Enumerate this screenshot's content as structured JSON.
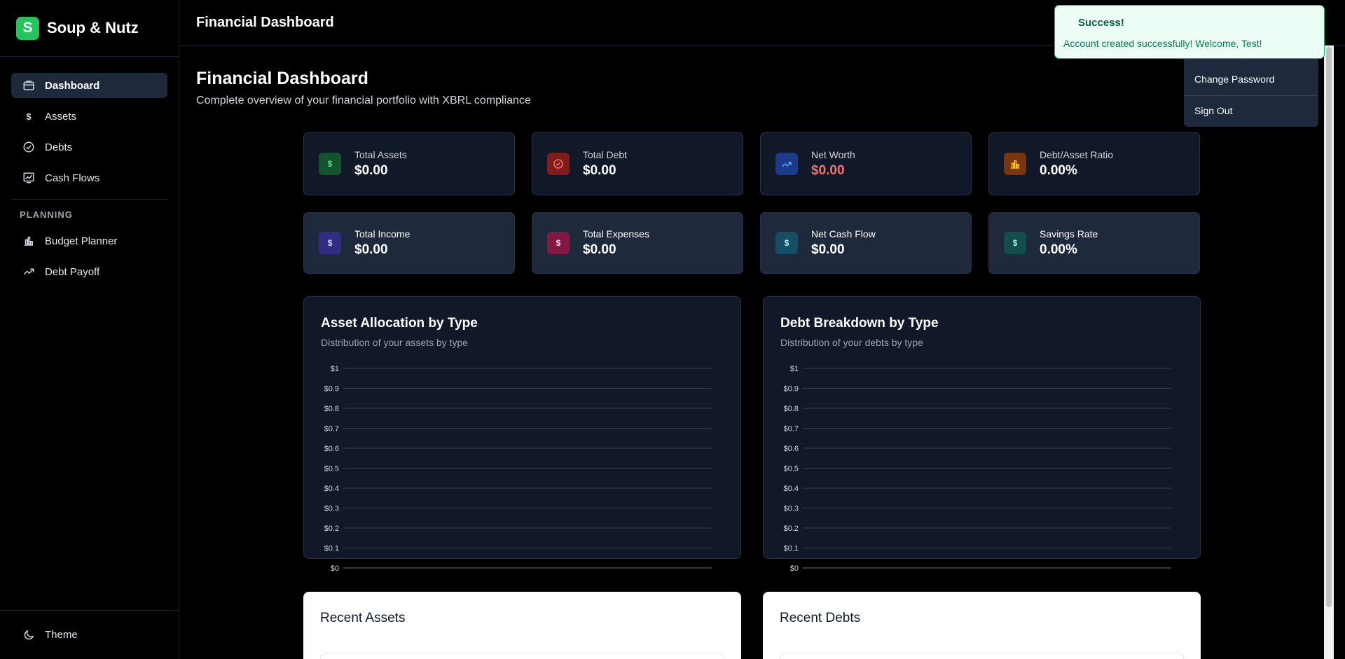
{
  "brand": {
    "logo_letter": "S",
    "name": "Soup & Nutz",
    "color": "#22c55e"
  },
  "sidebar": {
    "items": [
      {
        "label": "Dashboard",
        "icon": "dashboard-icon",
        "active": true
      },
      {
        "label": "Assets",
        "icon": "dollar-icon"
      },
      {
        "label": "Debts",
        "icon": "check-circle-icon"
      },
      {
        "label": "Cash Flows",
        "icon": "chart-line-icon"
      }
    ],
    "section_label": "PLANNING",
    "planning_items": [
      {
        "label": "Budget Planner",
        "icon": "bar-chart-icon"
      },
      {
        "label": "Debt Payoff",
        "icon": "trending-icon"
      }
    ],
    "theme_label": "Theme"
  },
  "header": {
    "title": "Financial Dashboard"
  },
  "page": {
    "title": "Financial Dashboard",
    "subtitle": "Complete overview of your financial portfolio with XBRL compliance"
  },
  "stats": [
    {
      "label": "Total Assets",
      "value": "$0.00",
      "icon": "dollar-icon",
      "icon_glyph": "$",
      "bg": "#14532d",
      "fg": "#4ade80"
    },
    {
      "label": "Total Debt",
      "value": "$0.00",
      "icon": "check-circle-icon",
      "bg": "#7f1d1d",
      "fg": "#f87171"
    },
    {
      "label": "Net Worth",
      "value": "$0.00",
      "icon": "trending-icon",
      "bg": "#1e3a8a",
      "fg": "#60a5fa",
      "negative": true
    },
    {
      "label": "Debt/Asset Ratio",
      "value": "0.00%",
      "icon": "bar-chart-icon",
      "bg": "#78350f",
      "fg": "#fbbf24"
    },
    {
      "label": "Total Income",
      "value": "$0.00",
      "icon": "dollar-icon",
      "icon_glyph": "$",
      "bg": "#312e81",
      "fg": "#a5b4fc"
    },
    {
      "label": "Total Expenses",
      "value": "$0.00",
      "icon": "dollar-icon",
      "icon_glyph": "$",
      "bg": "#831843",
      "fg": "#f9a8d4"
    },
    {
      "label": "Net Cash Flow",
      "value": "$0.00",
      "icon": "dollar-icon",
      "icon_glyph": "$",
      "bg": "#164e63",
      "fg": "#67e8f9"
    },
    {
      "label": "Savings Rate",
      "value": "0.00%",
      "icon": "dollar-icon",
      "icon_glyph": "$",
      "bg": "#134e4a",
      "fg": "#5eead4"
    }
  ],
  "charts": [
    {
      "title": "Asset Allocation by Type",
      "subtitle": "Distribution of your assets by type"
    },
    {
      "title": "Debt Breakdown by Type",
      "subtitle": "Distribution of your debts by type"
    }
  ],
  "chart_data": [
    {
      "type": "bar",
      "title": "Asset Allocation by Type",
      "subtitle": "Distribution of your assets by type",
      "categories": [],
      "values": [],
      "ylim": [
        0,
        1
      ],
      "yticks": [
        "$0",
        "$0.1",
        "$0.2",
        "$0.3",
        "$0.4",
        "$0.5",
        "$0.6",
        "$0.7",
        "$0.8",
        "$0.9",
        "$1"
      ],
      "grid": true
    },
    {
      "type": "bar",
      "title": "Debt Breakdown by Type",
      "subtitle": "Distribution of your debts by type",
      "categories": [],
      "values": [],
      "ylim": [
        0,
        1
      ],
      "yticks": [
        "$0",
        "$0.1",
        "$0.2",
        "$0.3",
        "$0.4",
        "$0.5",
        "$0.6",
        "$0.7",
        "$0.8",
        "$0.9",
        "$1"
      ],
      "grid": true
    }
  ],
  "recent": [
    {
      "title": "Recent Assets"
    },
    {
      "title": "Recent Debts"
    }
  ],
  "dropdown": {
    "items": [
      "Change Password",
      "Sign Out"
    ]
  },
  "toast": {
    "title": "Success!",
    "message": "Account created successfully! Welcome, Test!"
  }
}
